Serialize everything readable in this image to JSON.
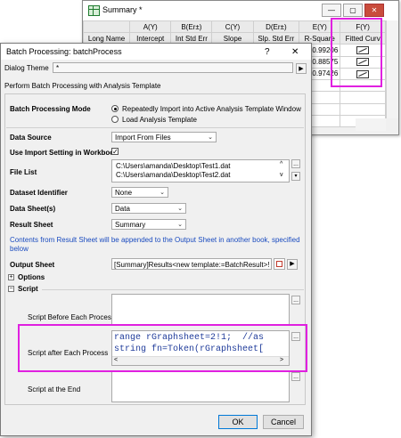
{
  "sheet": {
    "title": "Summary *",
    "controls": [
      "—",
      "▢",
      "✕"
    ],
    "headers": [
      "",
      "A(Y)",
      "B(Er±)",
      "C(Y)",
      "D(Er±)",
      "E(Y)",
      "F(Y)"
    ],
    "long_name_row": [
      "Long Name",
      "Intercept",
      "Int Std Err",
      "Slope",
      "Slp. Std Err",
      "R-Square",
      "Fitted Curv"
    ],
    "r_square_values": [
      "0.99206",
      "0.88575",
      "0.97426"
    ]
  },
  "dialog": {
    "title": "Batch Processing: batchProcess",
    "help": "?",
    "close": "✕",
    "theme_label": "Dialog Theme",
    "theme_value": "*",
    "theme_arrow": "▶",
    "description": "Perform Batch Processing with Analysis Template",
    "mode_label": "Batch Processing Mode",
    "mode_option1": "Repeatedly Import into Active Analysis Template Window",
    "mode_option2": "Load Analysis Template",
    "data_source_label": "Data Source",
    "data_source_value": "Import From Files",
    "use_import_label": "Use Import Setting in Workbook",
    "use_import_checked": "✓",
    "file_list_label": "File List",
    "files": [
      "C:\\Users\\amanda\\Desktop\\Test1.dat",
      "C:\\Users\\amanda\\Desktop\\Test2.dat"
    ],
    "dataset_id_label": "Dataset Identifier",
    "dataset_id_value": "None",
    "data_sheets_label": "Data Sheet(s)",
    "data_sheets_value": "Data",
    "result_sheet_label": "Result Sheet",
    "result_sheet_value": "Summary",
    "info_text": "Contents from Result Sheet will be appended to the Output Sheet in another book, specified below",
    "output_sheet_label": "Output Sheet",
    "output_sheet_value": "[Summary]Results<new template:=BatchResult>!",
    "options_label": "Options",
    "script_label": "Script",
    "script_before_label": "Script Before Each Process",
    "script_after_label": "Script after Each Process",
    "script_after_lines": [
      "range rGraphsheet=2!1;  //as",
      "string fn=Token(rGraphsheet["
    ],
    "script_end_label": "Script at the End",
    "ellipsis": "...",
    "ok": "OK",
    "cancel": "Cancel",
    "info_color": "#1a4bbf",
    "highlight_color": "#e020e0"
  }
}
